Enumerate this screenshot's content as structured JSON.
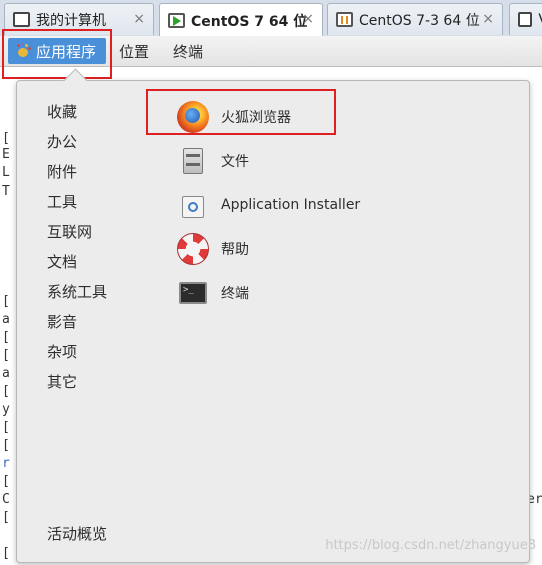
{
  "tabs": [
    {
      "label": "我的计算机",
      "icon": "monitor-icon",
      "close": "×",
      "active": false
    },
    {
      "label": "CentOS 7 64 位",
      "icon": "vm-running-icon",
      "close": "×",
      "active": true
    },
    {
      "label": "CentOS 7-3 64 位",
      "icon": "vm-paused-icon",
      "close": "×",
      "active": false
    },
    {
      "label": "V",
      "icon": "vm-icon",
      "close": "",
      "active": false
    }
  ],
  "topbar": {
    "applications": "应用程序",
    "places": "位置",
    "terminal": "终端"
  },
  "menu": {
    "categories": [
      "收藏",
      "办公",
      "附件",
      "工具",
      "互联网",
      "文档",
      "系统工具",
      "影音",
      "杂项",
      "其它"
    ],
    "activities": "活动概览",
    "apps": [
      {
        "label": "火狐浏览器",
        "icon": "firefox-icon"
      },
      {
        "label": "文件",
        "icon": "files-icon"
      },
      {
        "label": "Application Installer",
        "icon": "installer-icon"
      },
      {
        "label": "帮助",
        "icon": "help-icon"
      },
      {
        "label": "终端",
        "icon": "terminal-icon"
      }
    ]
  },
  "background_fragments": [
    "[",
    "E",
    "L",
    "T",
    "[",
    "a",
    "[",
    "[",
    "a",
    "[",
    "y",
    "[",
    "[",
    "r",
    "[",
    "C",
    "er",
    "[",
    "["
  ],
  "watermark": "https://blog.csdn.net/zhangyue8"
}
